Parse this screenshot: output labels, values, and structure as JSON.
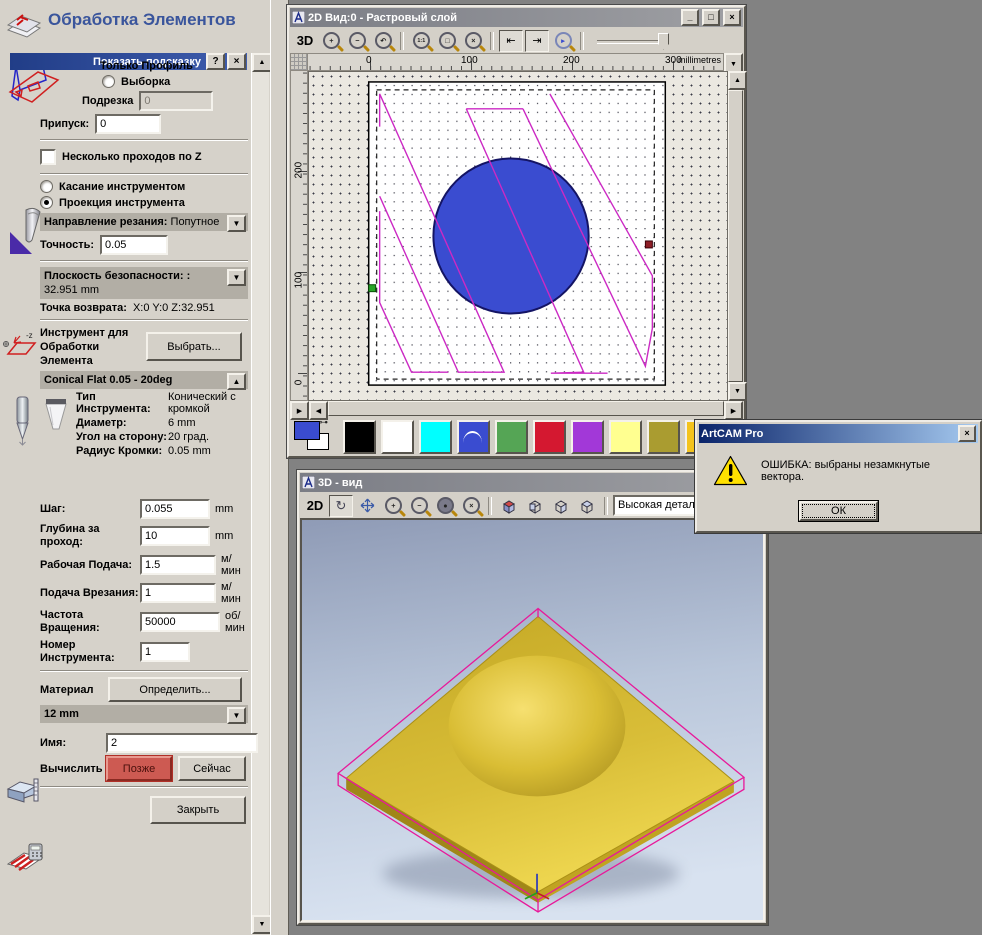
{
  "colors": {
    "workspace_bg": "#828282",
    "panel_bg": "#d6d2ca",
    "section_bar_bg": "#b2aea5",
    "panel_title_blue": "#3a559c",
    "toolpath_magenta": "#cc29c4",
    "vector_circle_blue": "#3a4cd0",
    "relief_gold": "#d8bc32",
    "active_title_from": "#0a246a",
    "active_title_to": "#a6caf0",
    "later_button_red": "#cd5a52"
  },
  "panel": {
    "title": "Обработка Элементов",
    "tooltip_bar": {
      "label": "Показать подсказку",
      "help": "?",
      "close": "×"
    },
    "profile_radio_label": "Только Профиль",
    "selection_radio_label": "Выборка",
    "trim_label": "Подрезка",
    "trim_value": "0",
    "allowance_label": "Припуск:",
    "allowance_value": "0",
    "multipass_label": "Несколько проходов по Z",
    "touch_radio_label": "Касание инструментом",
    "projection_radio_label": "Проекция инструмента",
    "direction_label": "Направление резания:",
    "direction_value": "Попутное",
    "tolerance_label": "Точность:",
    "tolerance_value": "0.05",
    "safe_plane_label": "Плоскость безопасности: :",
    "safe_plane_value": "32.951 mm",
    "return_point_label": "Точка возврата:",
    "return_point_value": "X:0 Y:0 Z:32.951",
    "tool_section_label": "Инструмент для Обработки Элемента",
    "select_tool_button": "Выбрать...",
    "tool_name": "Conical Flat 0.05 - 20deg",
    "tool_rows": [
      {
        "label": "Тип Инструмента:",
        "value": "Конический с кромкой"
      },
      {
        "label": "Диаметр:",
        "value": "6 mm"
      },
      {
        "label": "Угол на сторону:",
        "value": "20 град."
      },
      {
        "label": "Радиус Кромки:",
        "value": "0.05 mm"
      }
    ],
    "param_rows": [
      {
        "label": "Шаг:",
        "value": "0.055",
        "unit": "mm"
      },
      {
        "label": "Глубина за проход:",
        "value": "10",
        "unit": "mm"
      },
      {
        "label": "Рабочая Подача:",
        "value": "1.5",
        "unit": "м/мин"
      },
      {
        "label": "Подача Врезания:",
        "value": "1",
        "unit": "м/мин"
      },
      {
        "label": "Частота Вращения:",
        "value": "50000",
        "unit": "об/мин"
      },
      {
        "label": "Номер Инструмента:",
        "value": "1",
        "unit": ""
      }
    ],
    "material_label": "Материал",
    "material_button": "Определить...",
    "material_value": "12 mm",
    "name_label": "Имя:",
    "name_value": "2",
    "calculate_label": "Вычислить",
    "later_button": "Позже",
    "now_button": "Сейчас",
    "close_button": "Закрыть"
  },
  "view2d": {
    "title": "2D Вид:0 - Растровый слой",
    "btn_3d": "3D",
    "ruler_h_labels": [
      "0",
      "100",
      "200",
      "300"
    ],
    "ruler_units": "millimetres",
    "ruler_v_labels": [
      "200",
      "100",
      "0"
    ]
  },
  "view3d": {
    "title": "3D - вид",
    "btn_2d": "2D",
    "detail_dropdown_value": "Высокая детализация"
  },
  "dialog": {
    "title": "ArtCAM Pro",
    "message": "ОШИБКА: выбраны незамкнутые вектора.",
    "ok_button": "ОК"
  },
  "palette": {
    "swatches": [
      "#000000",
      "#ffffff",
      "#00ffff",
      "#3a4cd0",
      "#55a555",
      "#d41830",
      "#a238d8",
      "#ffff90",
      "#aa9c30",
      "#f4c31c"
    ],
    "selected_index": 3,
    "primary_color": "#3a4cd0",
    "secondary_color": "#ffffff"
  },
  "icons": {
    "up": "▲",
    "down": "▼",
    "left": "◀",
    "right": "▶",
    "zoom_in": "+",
    "zoom_out": "−",
    "zoom_prev": "↶",
    "zoom_11": "1:1",
    "zoom_rect": "□",
    "zoom_fit": "×",
    "zoom_pick": "▸",
    "rotate": "↻",
    "zoom_dark": "●",
    "page_left": "⇤",
    "page_right": "⇥",
    "dropdown": "▼",
    "dropup": "▲",
    "minimize": "_",
    "maximize": "□",
    "close": "×",
    "safe_z": "-z"
  }
}
